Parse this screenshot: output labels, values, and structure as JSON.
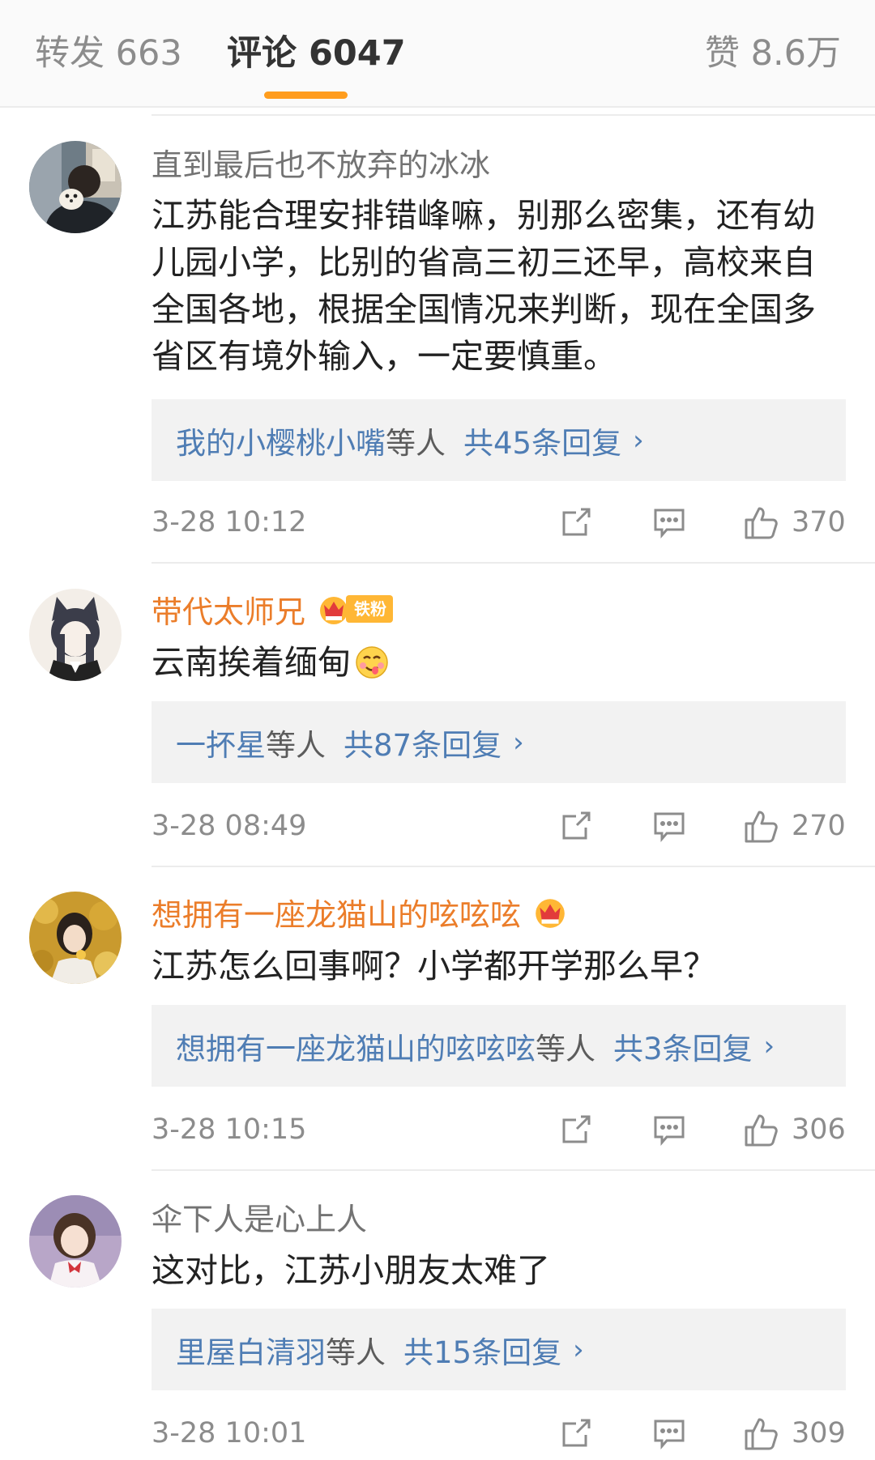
{
  "tabs": {
    "repost": "转发 663",
    "comment": "评论 6047",
    "like": "赞 8.6万"
  },
  "colors": {
    "accent": "#ff9d1d",
    "link": "#4f7db4",
    "vip_name": "#eb7d2a"
  },
  "comments": [
    {
      "name": "直到最后也不放弃的冰冰",
      "text": "江苏能合理安排错峰嘛，别那么密集，还有幼儿园小学，比别的省高三初三还早，高校来自全国各地，根据全国情况来判断，现在全国多省区有境外输入，一定要慎重。",
      "reply_names": "我的小樱桃小嘴",
      "reply_etc": "等人",
      "reply_count": "共45条回复",
      "chevron": "›",
      "time": "3-28 10:12",
      "likes": "370"
    },
    {
      "name": "带代太师兄",
      "badge_label": "铁粉",
      "text": "云南挨着缅甸",
      "emoji": "yum-emoji",
      "reply_names": "一抔星",
      "reply_etc": "等人",
      "reply_count": "共87条回复",
      "chevron": "›",
      "time": "3-28 08:49",
      "likes": "270"
    },
    {
      "name": "想拥有一座龙猫山的呟呟呟",
      "text": "江苏怎么回事啊？小学都开学那么早？",
      "reply_names": "想拥有一座龙猫山的呟呟呟",
      "reply_etc": "等人",
      "reply_count": "共3条回复",
      "chevron": "›",
      "time": "3-28 10:15",
      "likes": "306"
    },
    {
      "name": "伞下人是心上人",
      "text": "这对比，江苏小朋友太难了",
      "reply_names": "里屋白清羽",
      "reply_etc": "等人",
      "reply_count": "共15条回复",
      "chevron": "›",
      "time": "3-28 10:01",
      "likes": "309"
    }
  ],
  "icons": {
    "share": "share-icon",
    "reply": "comment-icon",
    "like": "thumbs-up-icon",
    "vip": "crown-badge-icon"
  }
}
